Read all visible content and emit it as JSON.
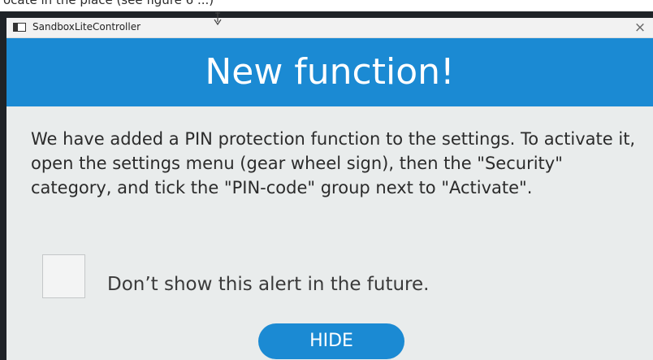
{
  "window": {
    "title": "SandboxLiteController",
    "close_glyph": "×"
  },
  "banner": {
    "title": "New function!",
    "color": "#1b8ad3"
  },
  "message": "We have added a PIN protection function to the settings. To activate it, open the settings menu (gear wheel sign), then the \"Security\" category, and tick the \"PIN-code\" group next to \"Activate\".",
  "checkbox": {
    "label": "Don’t show this alert in the future.",
    "checked": false
  },
  "buttons": {
    "hide_label": "HIDE"
  },
  "icons": {
    "app": "app-window-icon",
    "cursor": "mouse-cursor-icon",
    "close": "close-icon"
  }
}
